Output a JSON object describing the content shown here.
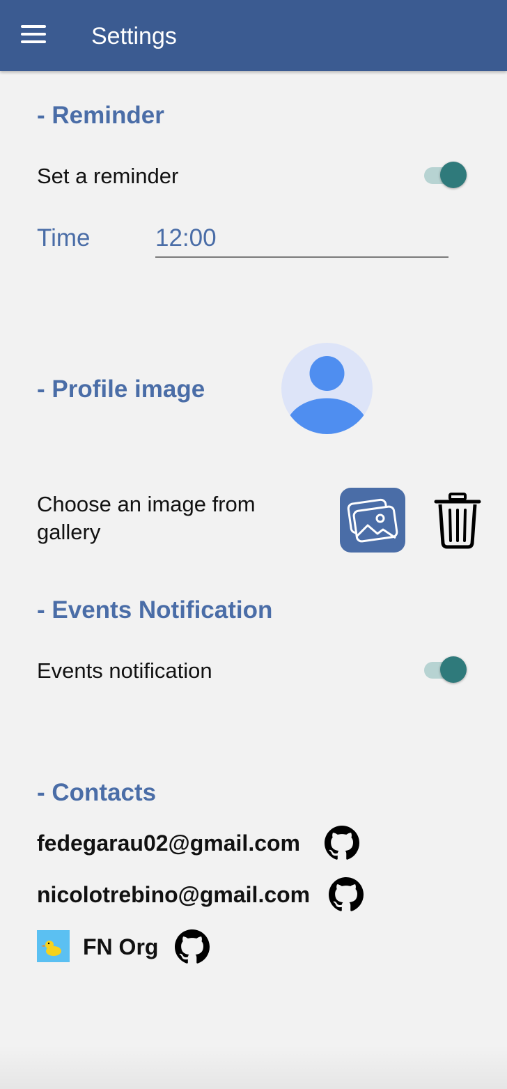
{
  "appbar": {
    "title": "Settings",
    "menu_icon": "menu-icon"
  },
  "reminder": {
    "section_title": "- Reminder",
    "toggle_label": "Set a reminder",
    "toggle_on": true,
    "time_label": "Time",
    "time_value": "12:00"
  },
  "profile": {
    "section_title": "- Profile image",
    "choose_label": "Choose an image from gallery",
    "gallery_icon": "gallery-icon",
    "delete_icon": "trash-icon"
  },
  "events": {
    "section_title": "- Events Notification",
    "toggle_label": "Events notification",
    "toggle_on": true
  },
  "contacts": {
    "section_title": "- Contacts",
    "items": [
      {
        "email": "fedegarau02@gmail.com",
        "icon": "github-icon"
      },
      {
        "email": "nicolotrebino@gmail.com",
        "icon": "github-icon"
      }
    ],
    "org": {
      "name": "FN Org",
      "logo": "duck-logo",
      "icon": "github-icon"
    }
  },
  "colors": {
    "appbar": "#3b5b91",
    "accent": "#4a6da7",
    "switch_thumb": "#2f7a7b",
    "switch_track": "#b7d3d2",
    "background": "#f2f2f2"
  }
}
